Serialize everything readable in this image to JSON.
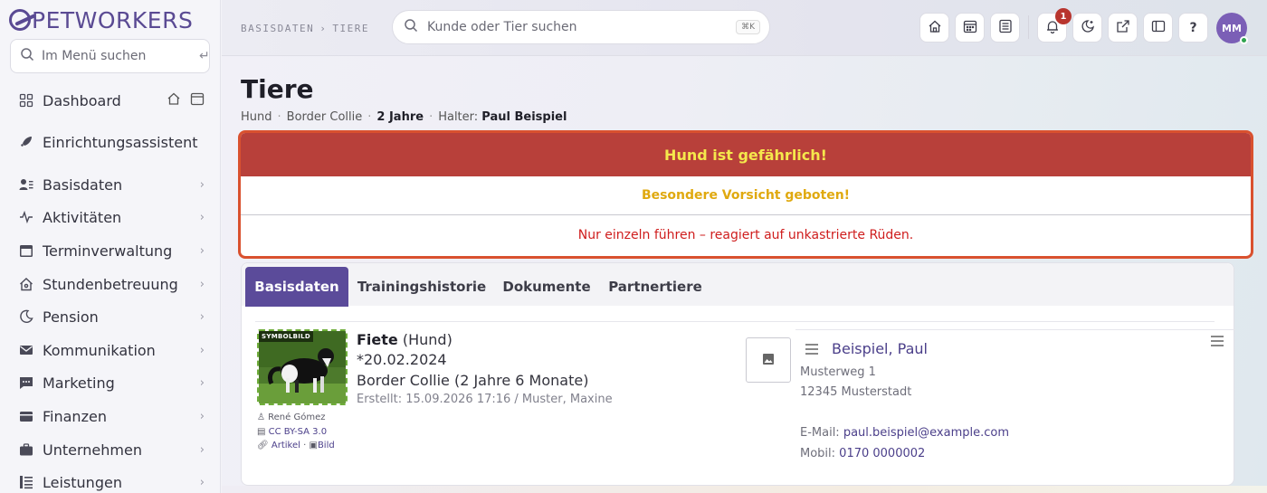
{
  "app": {
    "logo_text": "PETWORKERS"
  },
  "sidebar": {
    "search_placeholder": "Im Menü suchen",
    "items": [
      {
        "label": "Dashboard",
        "icon": "grid-icon"
      },
      {
        "label": "Einrichtungsassistent",
        "icon": "rocket-icon"
      },
      {
        "label": "Basisdaten",
        "icon": "users-list-icon"
      },
      {
        "label": "Aktivitäten",
        "icon": "activity-icon"
      },
      {
        "label": "Terminverwaltung",
        "icon": "calendar-icon"
      },
      {
        "label": "Stundenbetreuung",
        "icon": "house-icon"
      },
      {
        "label": "Pension",
        "icon": "moon-icon"
      },
      {
        "label": "Kommunikation",
        "icon": "mail-icon"
      },
      {
        "label": "Marketing",
        "icon": "chat-icon"
      },
      {
        "label": "Finanzen",
        "icon": "wallet-icon"
      },
      {
        "label": "Unternehmen",
        "icon": "briefcase-icon"
      },
      {
        "label": "Leistungen",
        "icon": "list-icon"
      }
    ]
  },
  "header": {
    "breadcrumb": [
      "BASISDATEN",
      "TIERE"
    ],
    "search_placeholder": "Kunde oder Tier suchen",
    "search_shortcut": "⌘K",
    "notification_count": "1",
    "avatar_initials": "MM"
  },
  "page": {
    "title": "Tiere",
    "species": "Hund",
    "breed": "Border Collie",
    "age": "2 Jahre",
    "owner_label": "Halter:",
    "owner_name": "Paul Beispiel"
  },
  "alert": {
    "headline": "Hund ist gefährlich!",
    "subline": "Besondere Vorsicht geboten!",
    "message": "Nur einzeln führen – reagiert auf unkastrierte Rüden."
  },
  "tabs": [
    "Basisdaten",
    "Trainingshistorie",
    "Dokumente",
    "Partnertiere"
  ],
  "pet": {
    "photo_tag": "SYMBOLBILD",
    "name": "Fiete",
    "species_paren": "(Hund)",
    "birthdate": "*20.02.2024",
    "breed_age": "Border Collie (2 Jahre 6 Monate)",
    "created": "Erstellt: 15.09.2026 17:16 / Muster, Maxine",
    "credit_author": "René Gómez",
    "credit_license": "CC BY-SA 3.0",
    "credit_article": "Artikel",
    "credit_sep": "·",
    "credit_image": "Bild"
  },
  "owner": {
    "name": "Beispiel, Paul",
    "street": "Musterweg 1",
    "city": "12345 Musterstadt",
    "email_label": "E-Mail:",
    "email": "paul.beispiel@example.com",
    "mobile_label": "Mobil:",
    "mobile": "0170 0000002"
  }
}
